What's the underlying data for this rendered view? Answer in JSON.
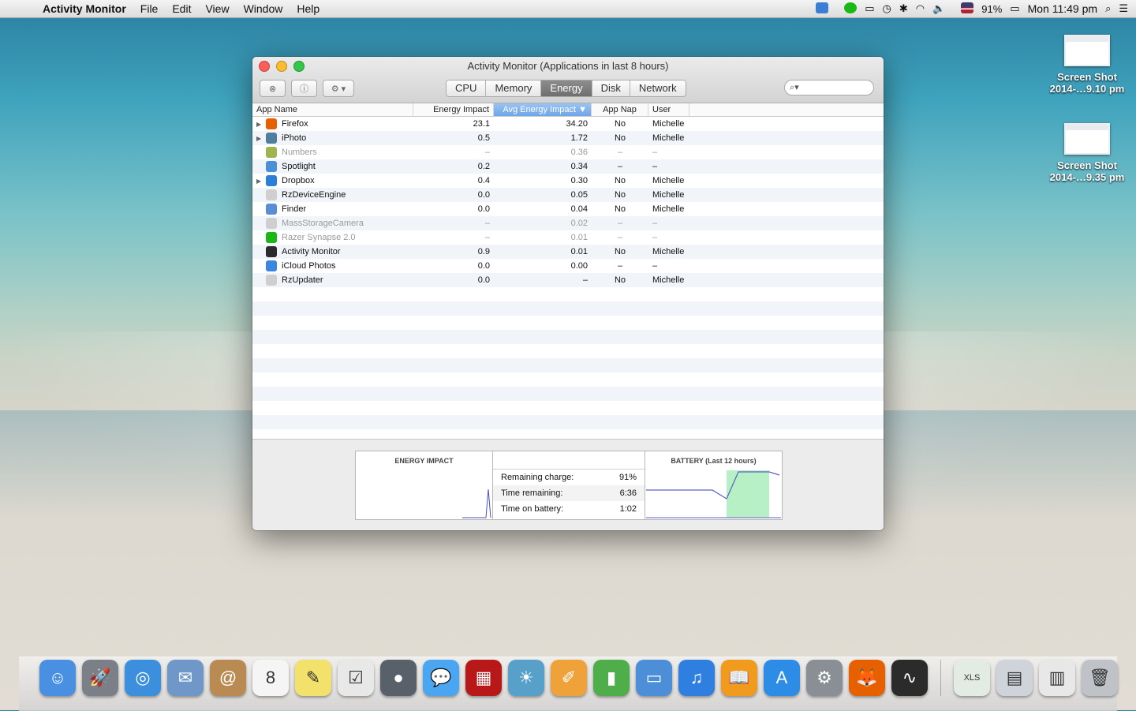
{
  "menubar": {
    "apple": "",
    "app_name": "Activity Monitor",
    "menus": [
      "File",
      "Edit",
      "View",
      "Window",
      "Help"
    ],
    "battery": "91%",
    "clock": "Mon 11:49 pm"
  },
  "desktop": {
    "icons": [
      {
        "line1": "Screen Shot",
        "line2": "2014-…9.10 pm"
      },
      {
        "line1": "Screen Shot",
        "line2": "2014-…9.35 pm"
      }
    ]
  },
  "window": {
    "title": "Activity Monitor (Applications in last 8 hours)",
    "tabs": [
      "CPU",
      "Memory",
      "Energy",
      "Disk",
      "Network"
    ],
    "active_tab": "Energy",
    "columns": {
      "name": "App Name",
      "energy_impact": "Energy Impact",
      "avg_energy_impact": "Avg Energy Impact ▼",
      "app_nap": "App Nap",
      "user": "User"
    },
    "rows": [
      {
        "name": "Firefox",
        "ei": "23.1",
        "aei": "34.20",
        "nap": "No",
        "user": "Michelle",
        "disc": "▶",
        "color": "#e66000",
        "dim": false
      },
      {
        "name": "iPhoto",
        "ei": "0.5",
        "aei": "1.72",
        "nap": "No",
        "user": "Michelle",
        "disc": "▶",
        "color": "#4f7e9e",
        "dim": false
      },
      {
        "name": "Numbers",
        "ei": "–",
        "aei": "0.36",
        "nap": "–",
        "user": "–",
        "disc": "",
        "color": "#9fb44e",
        "dim": true
      },
      {
        "name": "Spotlight",
        "ei": "0.2",
        "aei": "0.34",
        "nap": "–",
        "user": "–",
        "disc": "",
        "color": "#4a8fd8",
        "dim": false
      },
      {
        "name": "Dropbox",
        "ei": "0.4",
        "aei": "0.30",
        "nap": "No",
        "user": "Michelle",
        "disc": "▶",
        "color": "#2a7fd8",
        "dim": false
      },
      {
        "name": "RzDeviceEngine",
        "ei": "0.0",
        "aei": "0.05",
        "nap": "No",
        "user": "Michelle",
        "disc": "",
        "color": "#cfcfcf",
        "dim": false
      },
      {
        "name": "Finder",
        "ei": "0.0",
        "aei": "0.04",
        "nap": "No",
        "user": "Michelle",
        "disc": "",
        "color": "#5b8dd6",
        "dim": false
      },
      {
        "name": "MassStorageCamera",
        "ei": "–",
        "aei": "0.02",
        "nap": "–",
        "user": "–",
        "disc": "",
        "color": "#cfcfcf",
        "dim": true
      },
      {
        "name": "Razer Synapse 2.0",
        "ei": "–",
        "aei": "0.01",
        "nap": "–",
        "user": "–",
        "disc": "",
        "color": "#19b815",
        "dim": true
      },
      {
        "name": "Activity Monitor",
        "ei": "0.9",
        "aei": "0.01",
        "nap": "No",
        "user": "Michelle",
        "disc": "",
        "color": "#2b2b2b",
        "dim": false
      },
      {
        "name": "iCloud Photos",
        "ei": "0.0",
        "aei": "0.00",
        "nap": "–",
        "user": "–",
        "disc": "",
        "color": "#3a86e0",
        "dim": false
      },
      {
        "name": "RzUpdater",
        "ei": "0.0",
        "aei": "–",
        "nap": "No",
        "user": "Michelle",
        "disc": "",
        "color": "#cfcfcf",
        "dim": false
      }
    ],
    "empty_rows": 11,
    "panel": {
      "energy_title": "ENERGY IMPACT",
      "battery_title": "BATTERY (Last 12 hours)",
      "stats": [
        {
          "label": "Remaining charge:",
          "value": "91%"
        },
        {
          "label": "Time remaining:",
          "value": "6:36"
        },
        {
          "label": "Time on battery:",
          "value": "1:02"
        }
      ]
    }
  },
  "dock": {
    "apps": [
      {
        "name": "finder-dock-icon",
        "color": "#4a90e2",
        "glyph": "☺"
      },
      {
        "name": "launchpad-dock-icon",
        "color": "#7a7f88",
        "glyph": "🚀"
      },
      {
        "name": "safari-dock-icon",
        "color": "#3b8fdc",
        "glyph": "◎"
      },
      {
        "name": "mail-dock-icon",
        "color": "#6f98c8",
        "glyph": "✉"
      },
      {
        "name": "contacts-dock-icon",
        "color": "#b98a52",
        "glyph": "@"
      },
      {
        "name": "calendar-dock-icon",
        "color": "#f5f5f5",
        "glyph": "8"
      },
      {
        "name": "notes-dock-icon",
        "color": "#f2e16b",
        "glyph": "✎"
      },
      {
        "name": "reminders-dock-icon",
        "color": "#e8e8e8",
        "glyph": "☑"
      },
      {
        "name": "facetime-dock-icon",
        "color": "#58606a",
        "glyph": "●"
      },
      {
        "name": "messages-dock-icon",
        "color": "#4aa6f0",
        "glyph": "💬"
      },
      {
        "name": "photo-booth-dock-icon",
        "color": "#b81818",
        "glyph": "▦"
      },
      {
        "name": "iphoto-dock-icon",
        "color": "#56a0c9",
        "glyph": "☀"
      },
      {
        "name": "pages-dock-icon",
        "color": "#f0a23a",
        "glyph": "✐"
      },
      {
        "name": "numbers-dock-icon",
        "color": "#4fae49",
        "glyph": "▮"
      },
      {
        "name": "keynote-dock-icon",
        "color": "#4c8ed8",
        "glyph": "▭"
      },
      {
        "name": "itunes-dock-icon",
        "color": "#2f7fe0",
        "glyph": "♫"
      },
      {
        "name": "ibooks-dock-icon",
        "color": "#f09a1e",
        "glyph": "📖"
      },
      {
        "name": "app-store-dock-icon",
        "color": "#2d8de6",
        "glyph": "A"
      },
      {
        "name": "system-preferences-dock-icon",
        "color": "#8a8f96",
        "glyph": "⚙"
      },
      {
        "name": "firefox-dock-icon",
        "color": "#e66000",
        "glyph": "🦊"
      },
      {
        "name": "activity-monitor-dock-icon",
        "color": "#2b2b2b",
        "glyph": "∿"
      }
    ],
    "stacks": [
      {
        "name": "xls-file-dock-icon",
        "color": "#e3ece3",
        "glyph": "XLS"
      },
      {
        "name": "documents-stack-dock-icon",
        "color": "#cfd4da",
        "glyph": "▤"
      },
      {
        "name": "downloads-stack-dock-icon",
        "color": "#e8e8e8",
        "glyph": "▥"
      },
      {
        "name": "trash-dock-icon",
        "color": "#bfc3c8",
        "glyph": "🗑"
      }
    ]
  }
}
